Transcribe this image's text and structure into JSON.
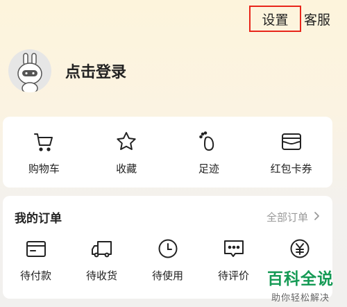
{
  "header": {
    "settings_label": "设置",
    "service_label": "客服",
    "highlight_color": "#e8251a"
  },
  "profile": {
    "login_label": "点击登录",
    "avatar_icon": "robot-avatar-icon"
  },
  "quick_links": [
    {
      "label": "购物车",
      "icon": "cart-icon"
    },
    {
      "label": "收藏",
      "icon": "star-icon"
    },
    {
      "label": "足迹",
      "icon": "footprint-icon"
    },
    {
      "label": "红包卡券",
      "icon": "wallet-card-icon"
    }
  ],
  "orders": {
    "title": "我的订单",
    "all_label": "全部订单",
    "items": [
      {
        "label": "待付款",
        "icon": "payment-card-icon"
      },
      {
        "label": "待收货",
        "icon": "delivery-truck-icon"
      },
      {
        "label": "待使用",
        "icon": "clock-icon"
      },
      {
        "label": "待评价",
        "icon": "comment-icon"
      },
      {
        "label": "",
        "icon": "yen-icon"
      }
    ]
  },
  "watermark": {
    "title": "百科全说",
    "subtitle": "助你轻松解决",
    "color": "#159a55"
  }
}
